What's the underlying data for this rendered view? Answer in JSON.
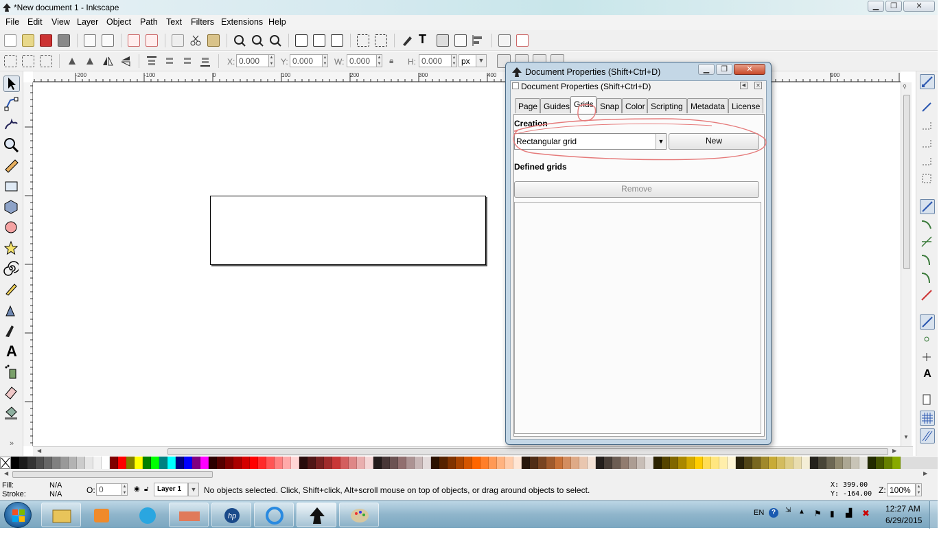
{
  "window": {
    "title": "*New document 1 - Inkscape"
  },
  "menu": [
    "File",
    "Edit",
    "View",
    "Layer",
    "Object",
    "Path",
    "Text",
    "Filters",
    "Extensions",
    "Help"
  ],
  "select_toolbar": {
    "x_label": "X:",
    "x_value": "0.000",
    "y_label": "Y:",
    "y_value": "0.000",
    "w_label": "W:",
    "w_value": "0.000",
    "h_label": "H:",
    "h_value": "0.000",
    "unit": "px"
  },
  "ruler": {
    "h_labels": [
      "-200",
      "-100",
      "0",
      "100",
      "200",
      "300",
      "400",
      "900"
    ]
  },
  "dialog": {
    "title": "Document Properties (Shift+Ctrl+D)",
    "panel_title": "Document Properties (Shift+Ctrl+D)",
    "tabs": [
      "Page",
      "Guides",
      "Grids",
      "Snap",
      "Color",
      "Scripting",
      "Metadata",
      "License"
    ],
    "active_tab": "Grids",
    "creation_label": "Creation",
    "grid_type": "Rectangular grid",
    "new_button": "New",
    "defined_label": "Defined grids",
    "remove_button": "Remove"
  },
  "palette_colors": [
    "#000000",
    "#1a1a1a",
    "#333333",
    "#4d4d4d",
    "#666666",
    "#808080",
    "#999999",
    "#b3b3b3",
    "#cccccc",
    "#e6e6e6",
    "#f2f2f2",
    "#ffffff",
    "#800000",
    "#ff0000",
    "#808000",
    "#ffff00",
    "#008000",
    "#00ff00",
    "#008080",
    "#00ffff",
    "#000080",
    "#0000ff",
    "#800080",
    "#ff00ff",
    "#2b0000",
    "#550000",
    "#800000",
    "#aa0000",
    "#d40000",
    "#ff0000",
    "#ff2a2a",
    "#ff5555",
    "#ff8080",
    "#ffaaaa",
    "#ffd5d5",
    "#280b0b",
    "#501616",
    "#782121",
    "#a02c2c",
    "#c83737",
    "#d35f5f",
    "#de8787",
    "#e9afaf",
    "#f4d7d7",
    "#241c1c",
    "#483737",
    "#6c5353",
    "#916f6f",
    "#ac9393",
    "#c8b7b7",
    "#e3dbdb",
    "#2b1100",
    "#552200",
    "#803300",
    "#aa4400",
    "#d45500",
    "#ff6600",
    "#ff7f2a",
    "#ff9955",
    "#ffb380",
    "#ffccaa",
    "#ffe6d5",
    "#28170b",
    "#502d16",
    "#784421",
    "#a05a2c",
    "#c87137",
    "#d38d5f",
    "#deaa87",
    "#e9c6af",
    "#f4e3d7",
    "#241f1c",
    "#483e37",
    "#6c5d53",
    "#917c6f",
    "#ac9d93",
    "#c8beb7",
    "#e3dedb",
    "#2b2200",
    "#554400",
    "#806600",
    "#aa8800",
    "#d4aa00",
    "#ffcc00",
    "#ffdd55",
    "#ffe680",
    "#ffeeaa",
    "#fff6d5",
    "#28220b",
    "#504416",
    "#786721",
    "#a0892c",
    "#c8ab37",
    "#d3bc5f",
    "#decd87",
    "#e9ddaf",
    "#f4eed7",
    "#24221c",
    "#484537",
    "#6c6753",
    "#918a6f",
    "#aca793",
    "#c8c4b7",
    "#e3e2db",
    "#222b00",
    "#445500",
    "#668000",
    "#88aa00"
  ],
  "status": {
    "fill_label": "Fill:",
    "fill_value": "N/A",
    "stroke_label": "Stroke:",
    "stroke_value": "N/A",
    "opacity_label": "O:",
    "opacity_value": "0",
    "layer": "Layer 1",
    "message": "No objects selected. Click, Shift+click, Alt+scroll mouse on top of objects, or drag around objects to select.",
    "coord_x": "X:  399.00",
    "coord_y": "Y: -164.00",
    "zoom_label": "Z:",
    "zoom_value": "100%"
  },
  "taskbar": {
    "lang": "EN",
    "time": "12:27 AM",
    "date": "6/29/2015"
  }
}
